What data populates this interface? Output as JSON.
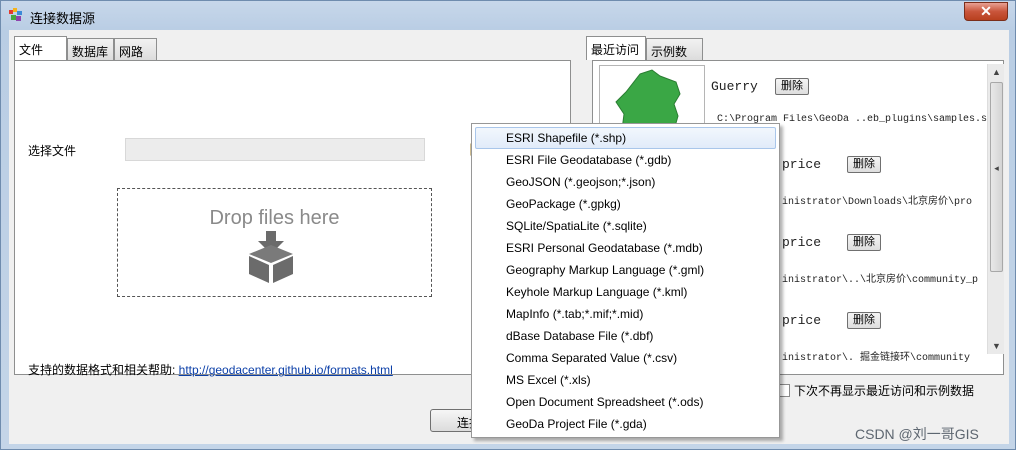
{
  "window": {
    "title": "连接数据源",
    "close_label": "✕"
  },
  "left_tabs": [
    {
      "label": "文件"
    },
    {
      "label": "数据库"
    },
    {
      "label": "网路"
    }
  ],
  "file": {
    "label": "选择文件",
    "input_value": "",
    "drop_text": "Drop files here",
    "help_text": "支持的数据格式和相关帮助: ",
    "help_link": "http://geodacenter.github.io/formats.html"
  },
  "right_tabs": [
    {
      "label": "最近访问"
    },
    {
      "label": "示例数据"
    }
  ],
  "recent": [
    {
      "title": "Guerry",
      "path": "C:\\Program Files\\GeoDa ..eb_plugins\\samples.s",
      "delete_label": "删除"
    },
    {
      "title": "price",
      "path": "inistrator\\Downloads\\北京房价\\pro",
      "delete_label": "删除"
    },
    {
      "title": "price",
      "path": "inistrator\\..\\北京房价\\community_p",
      "delete_label": "删除"
    },
    {
      "title": "price",
      "path": "inistrator\\. 掘金链接环\\community",
      "delete_label": "删除"
    }
  ],
  "checkbox_label": "下次不再显示最近访问和示例数据",
  "connect_label": "连接",
  "menu_items": [
    "ESRI Shapefile (*.shp)",
    "ESRI File Geodatabase (*.gdb)",
    "GeoJSON (*.geojson;*.json)",
    "GeoPackage (*.gpkg)",
    "SQLite/SpatiaLite (*.sqlite)",
    "ESRI Personal Geodatabase (*.mdb)",
    "Geography Markup Language (*.gml)",
    "Keyhole Markup Language (*.kml)",
    "MapInfo (*.tab;*.mif;*.mid)",
    "dBase Database File (*.dbf)",
    "Comma Separated Value (*.csv)",
    "MS Excel (*.xls)",
    "Open Document Spreadsheet (*.ods)",
    "GeoDa Project File (*.gda)"
  ],
  "watermark": "CSDN @刘一哥GIS"
}
